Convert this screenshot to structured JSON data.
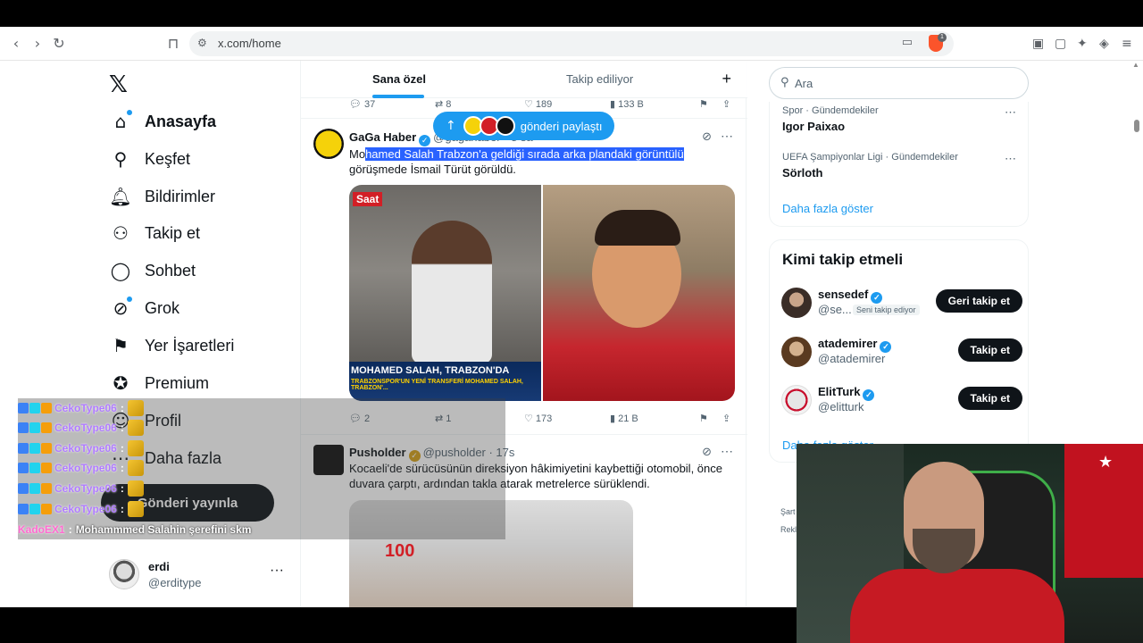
{
  "browser": {
    "url": "x.com/home",
    "shield_badge": "1"
  },
  "sidebar": {
    "items": [
      {
        "label": "Anasayfa",
        "icon": "home-icon"
      },
      {
        "label": "Keşfet",
        "icon": "search-icon"
      },
      {
        "label": "Bildirimler",
        "icon": "bell-icon"
      },
      {
        "label": "Takip et",
        "icon": "person-add-icon"
      },
      {
        "label": "Sohbet",
        "icon": "chat-icon"
      },
      {
        "label": "Grok",
        "icon": "grok-icon"
      },
      {
        "label": "Yer İşaretleri",
        "icon": "bookmark-icon"
      },
      {
        "label": "Premium",
        "icon": "premium-icon"
      },
      {
        "label": "Profil",
        "icon": "profile-icon"
      },
      {
        "label": "Daha fazla",
        "icon": "more-icon"
      }
    ],
    "post_button": "Gönderi yayınla",
    "account": {
      "name": "erdi",
      "handle": "@erditype",
      "more": "···"
    }
  },
  "timeline": {
    "tabs": [
      "Sana özel",
      "Takip ediliyor"
    ],
    "plus": "+",
    "prev_actions": {
      "replies": "37",
      "reposts": "8",
      "likes": "189",
      "views": "133 B"
    },
    "new_posts_label": "gönderi paylaştı",
    "tweet1": {
      "name": "GaGa Haber",
      "handle": "@gagahaber · 8 sa",
      "text_hl_prefix": "Mo",
      "text_hl": "hamed Salah Trabzon'a geldiği sırada arka plandaki görüntülü",
      "text_rest": "görüşmede İsmail Türüt görüldü.",
      "media_tag": "Saat",
      "caption_title": "MOHAMED SALAH, TRABZON'DA",
      "caption_sub": "TRABZONSPOR'UN YENİ TRANSFERİ MOHAMED SALAH, TRABZON'...",
      "actions": {
        "replies": "2",
        "reposts": "1",
        "likes": "173",
        "views": "21 B"
      }
    },
    "tweet2": {
      "name": "Pusholder",
      "handle": "@pusholder · 17s",
      "text": "Kocaeli'de sürücüsünün direksiyon hâkimiyetini kaybettiği otomobil, önce duvara çarptı, ardından takla atarak metrelerce sürüklendi.",
      "video_logo": "100"
    }
  },
  "right": {
    "search_placeholder": "Ara",
    "trends": [
      {
        "meta": "Spor · Gündemdekiler",
        "title": "Igor Paixao"
      },
      {
        "meta": "UEFA Şampiyonlar Ligi · Gündemdekiler",
        "title": "Sörloth"
      }
    ],
    "trends_more": "Daha fazla göster",
    "wtf_title": "Kimi takip etmeli",
    "wtf": [
      {
        "name": "sensedef",
        "handle": "@se...",
        "follows_you": "Seni takip ediyor",
        "button": "Geri takip et"
      },
      {
        "name": "atademirer",
        "handle": "@atademirer",
        "button": "Takip et"
      },
      {
        "name": "ElitTurk",
        "handle": "@elitturk",
        "button": "Takip et"
      }
    ],
    "wtf_more": "Daha fazla göster",
    "footer1": "Şart",
    "footer2": "Rekl"
  },
  "chat": [
    {
      "user": "CekoType06",
      "msg": ""
    },
    {
      "user": "CekoType06",
      "msg": ""
    },
    {
      "user": "CekoType06",
      "msg": ""
    },
    {
      "user": "CekoType06",
      "msg": ""
    },
    {
      "user": "CekoType06",
      "msg": ""
    },
    {
      "user": "CekoType06",
      "msg": ""
    },
    {
      "user": "KadoEX1",
      "msg": "Mohammmed Salahin şerefini skm"
    }
  ],
  "colors": {
    "accent": "#1d9bf0",
    "dark": "#0f1419",
    "chat_user": "#b07cff"
  }
}
